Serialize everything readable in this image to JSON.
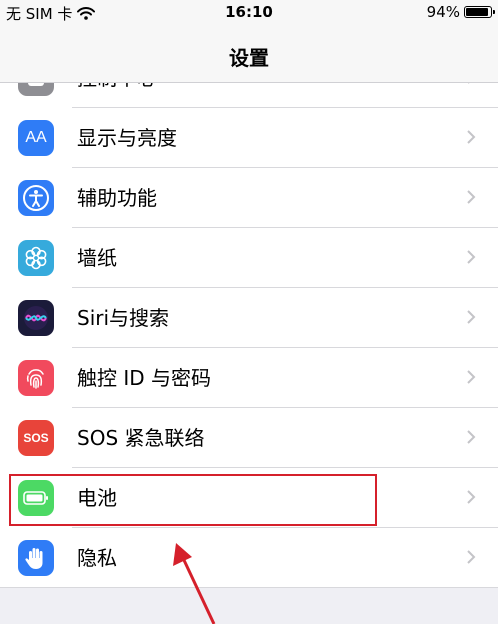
{
  "status_bar": {
    "carrier": "无 SIM 卡",
    "time": "16:10",
    "battery": "94%"
  },
  "nav": {
    "title": "设置"
  },
  "rows": [
    {
      "label": "控制中心",
      "icon": "control-center-icon",
      "color": "#8e8e93"
    },
    {
      "label": "显示与亮度",
      "icon": "display-brightness-icon",
      "color": "#2f7cf6",
      "glyph": "AA"
    },
    {
      "label": "辅助功能",
      "icon": "accessibility-icon",
      "color": "#2f7cf6"
    },
    {
      "label": "墙纸",
      "icon": "wallpaper-icon",
      "color": "#36aadc"
    },
    {
      "label": "Siri与搜索",
      "icon": "siri-icon",
      "color": "#1b1b3a"
    },
    {
      "label": "触控 ID 与密码",
      "icon": "touch-id-icon",
      "color": "#f14a5d"
    },
    {
      "label": "SOS 紧急联络",
      "icon": "sos-icon",
      "color": "#e8443a",
      "glyph": "SOS"
    },
    {
      "label": "电池",
      "icon": "battery-icon",
      "color": "#4cd964"
    },
    {
      "label": "隐私",
      "icon": "privacy-hand-icon",
      "color": "#2f7cf6"
    }
  ],
  "annotation": {
    "highlight_color": "#d5202b"
  }
}
